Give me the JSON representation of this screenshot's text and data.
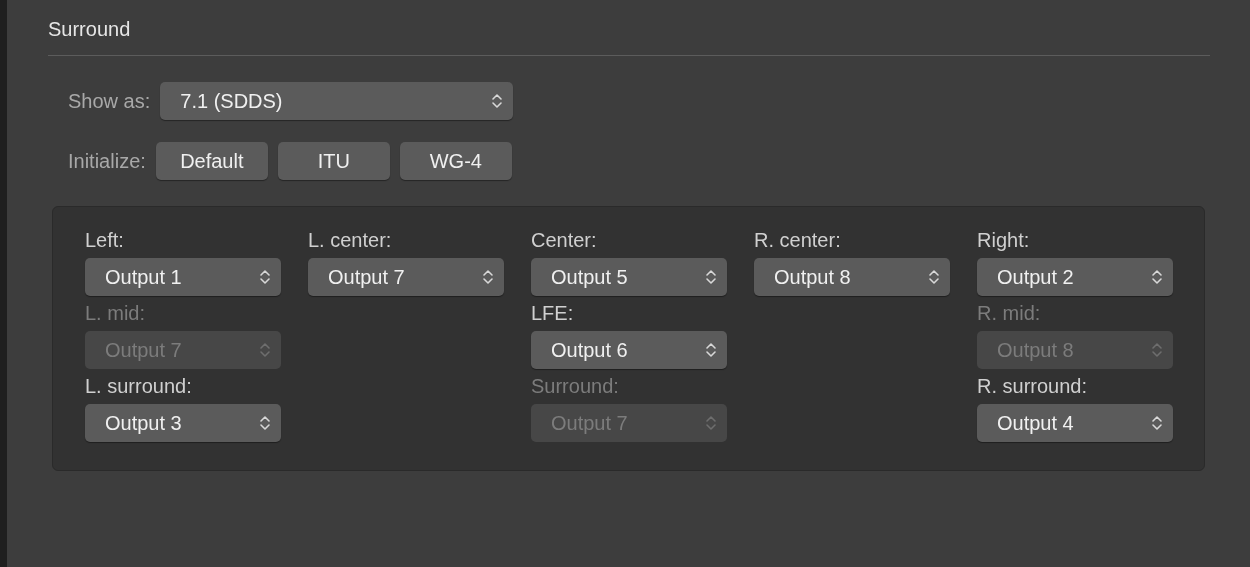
{
  "section": {
    "title": "Surround"
  },
  "show_as": {
    "label": "Show as:",
    "value": "7.1 (SDDS)"
  },
  "initialize": {
    "label": "Initialize:",
    "buttons": [
      "Default",
      "ITU",
      "WG-4"
    ]
  },
  "grid": {
    "rows": [
      [
        {
          "label": "Left:",
          "value": "Output 1",
          "disabled": false
        },
        {
          "label": "L. center:",
          "value": "Output 7",
          "disabled": false
        },
        {
          "label": "Center:",
          "value": "Output 5",
          "disabled": false
        },
        {
          "label": "R. center:",
          "value": "Output 8",
          "disabled": false
        },
        {
          "label": "Right:",
          "value": "Output 2",
          "disabled": false
        }
      ],
      [
        {
          "label": "L. mid:",
          "value": "Output 7",
          "disabled": true
        },
        null,
        {
          "label": "LFE:",
          "value": "Output 6",
          "disabled": false
        },
        null,
        {
          "label": "R. mid:",
          "value": "Output 8",
          "disabled": true
        }
      ],
      [
        {
          "label": "L. surround:",
          "value": "Output 3",
          "disabled": false
        },
        null,
        {
          "label": "Surround:",
          "value": "Output 7",
          "disabled": true
        },
        null,
        {
          "label": "R. surround:",
          "value": "Output 4",
          "disabled": false
        }
      ]
    ]
  }
}
